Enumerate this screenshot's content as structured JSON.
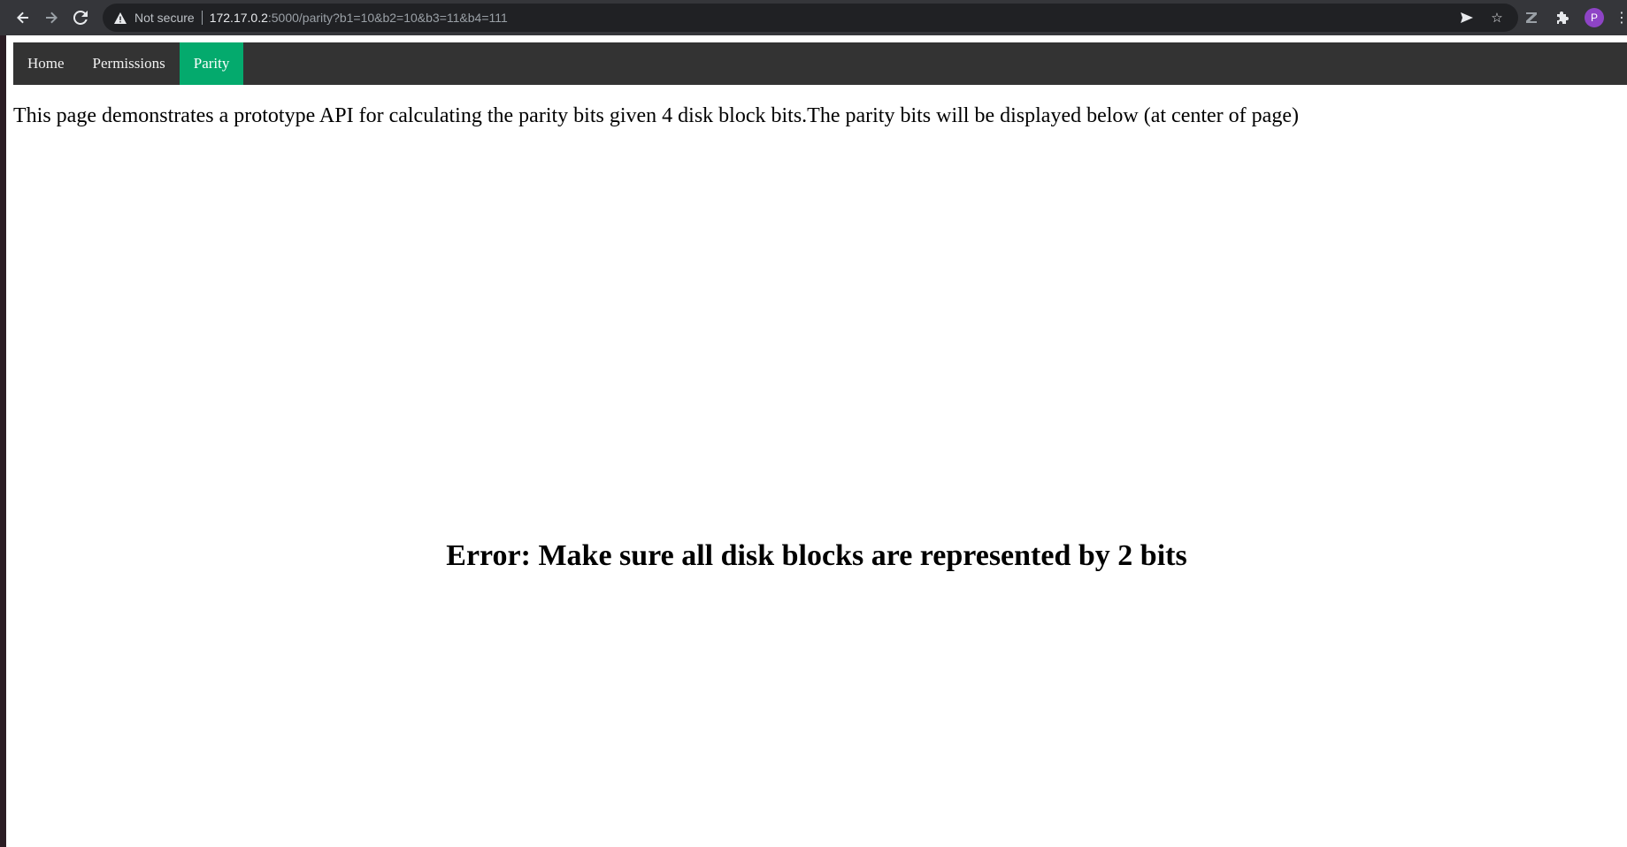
{
  "browser": {
    "nav": {
      "back_icon": "arrow-left-icon",
      "forward_icon": "arrow-right-icon",
      "reload_icon": "reload-icon"
    },
    "omnibox": {
      "security_label": "Not secure",
      "url_host": "172.17.0.2",
      "url_rest": ":5000/parity?b1=10&b2=10&b3=11&b4=111"
    },
    "icons": [
      "send-icon",
      "star-icon",
      "extension-z-icon",
      "puzzle-icon",
      "avatar",
      "menu-icon"
    ],
    "avatar_letter": "P"
  },
  "topnav": {
    "items": [
      {
        "label": "Home",
        "active": false
      },
      {
        "label": "Permissions",
        "active": false
      },
      {
        "label": "Parity",
        "active": true
      }
    ],
    "bg_color": "#333333",
    "active_color": "#04aa6d"
  },
  "content": {
    "intro_text": "This page demonstrates a prototype API for calculating the parity bits given 4 disk block bits.The parity bits will be displayed below (at center of page)",
    "result_text": "Error: Make sure all disk blocks are represented by 2 bits"
  }
}
